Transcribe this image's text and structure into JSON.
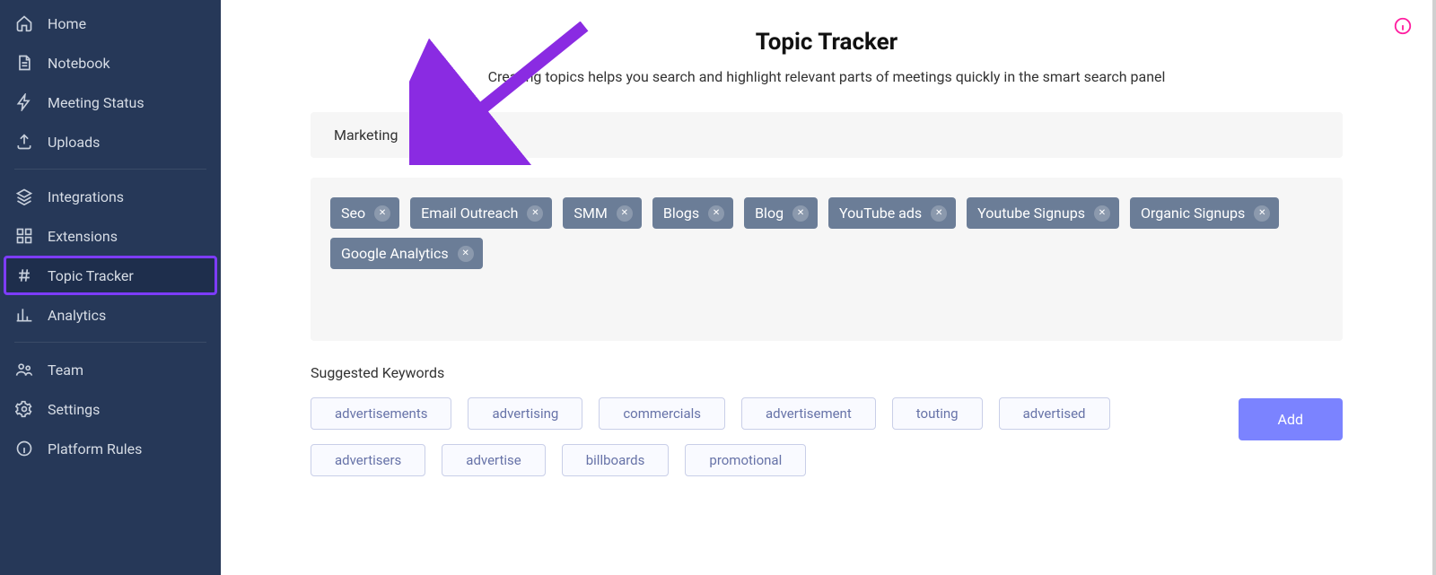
{
  "sidebar": {
    "items": [
      {
        "label": "Home"
      },
      {
        "label": "Notebook"
      },
      {
        "label": "Meeting Status"
      },
      {
        "label": "Uploads"
      },
      {
        "label": "Integrations"
      },
      {
        "label": "Extensions"
      },
      {
        "label": "Topic Tracker"
      },
      {
        "label": "Analytics"
      },
      {
        "label": "Team"
      },
      {
        "label": "Settings"
      },
      {
        "label": "Platform Rules"
      }
    ],
    "active_index": 6
  },
  "header": {
    "title": "Topic Tracker",
    "subtitle": "Creating topics helps you search and highlight relevant parts of meetings quickly in the smart search panel"
  },
  "topic": {
    "name": "Marketing",
    "tags": [
      "Seo",
      "Email Outreach",
      "SMM",
      "Blogs",
      "Blog",
      "YouTube ads",
      "Youtube Signups",
      "Organic Signups",
      "Google Analytics"
    ]
  },
  "suggested": {
    "label": "Suggested Keywords",
    "row1": [
      "advertisements",
      "advertising",
      "commercials",
      "advertisement",
      "touting",
      "advertised"
    ],
    "row2": [
      "advertisers",
      "advertise",
      "billboards",
      "promotional"
    ]
  },
  "buttons": {
    "add": "Add"
  },
  "colors": {
    "sidebar_bg": "#263858",
    "accent_purple": "#7d3cff",
    "tag_bg": "#6b7d97",
    "add_btn": "#7b83ff",
    "info_icon": "#ff1fa0"
  }
}
